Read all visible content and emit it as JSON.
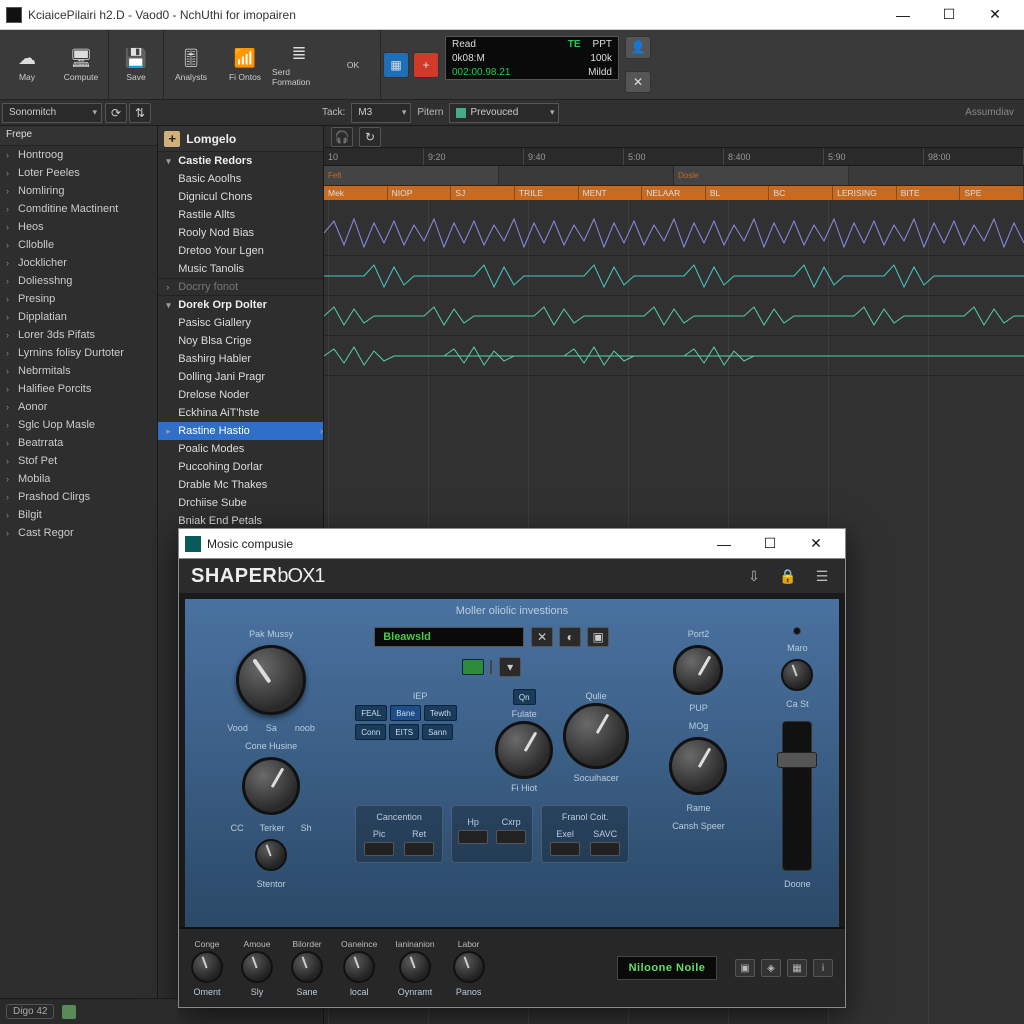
{
  "window": {
    "title": "KciaicePilairi h2.D - Vaod0 - NchUthi for imopairen"
  },
  "toolbar": {
    "may_label": "May",
    "compute_label": "Compute",
    "save_label": "Save",
    "analysts_label": "Analysts",
    "fi_ontos_label": "Fi Ontos",
    "serd_label": "Serd Formation",
    "ok_label": "OK"
  },
  "transport": {
    "lcd_top": {
      "mode": "Read",
      "te": "TE",
      "ppt": "PPT"
    },
    "lcd_bot": {
      "pos": "0k08:M",
      "rate": "100k"
    },
    "lcd_extra": {
      "bars": "002:00.98.21",
      "status": "Mildd"
    }
  },
  "subbar": {
    "search_label": "Sonomitch",
    "track_label": "Tack:",
    "track_value": "M3",
    "preset_label": "Pitern",
    "preset_value": "Prevouced",
    "rightlabel": "Assumdiav"
  },
  "left_header": "Frepe",
  "left_items": [
    "Hontroog",
    "Loter Peeles",
    "Nomliring",
    "Comditine Mactinent",
    "Heos",
    "Clloblle",
    "Jocklicher",
    "Doliesshng",
    "Presinp",
    "Dipplatian",
    "Lorer 3ds Pifats",
    "Lyrnins folisy Durtoter",
    "Nebrmitals",
    "Halifiee Porcits",
    "Aonor",
    "Sglc Uop Masle",
    "Beatrrata",
    "Stof Pet",
    "Mobila",
    "Prashod Clirgs",
    "Bilgit",
    "Cast Regor"
  ],
  "mid_title": "Lomgelo",
  "mid_groups": {
    "g1": "Castie Redors",
    "g1_items": [
      "Basic Aoolhs",
      "Dignicul Chons",
      "Rastile Allts",
      "Rooly Nod Bias",
      "Dretoo Your Lgen",
      "Music Tanolis"
    ],
    "placeholder": "Docrry fonot",
    "g2": "Dorek Orp Dolter",
    "g2_items": [
      "Pasisc Giallery",
      "Noy Blsa Crige",
      "Bashirg Habler",
      "Dolling Jani Pragr",
      "Drelose Noder",
      "Eckhina AiT'hste",
      "Rastine Hastio",
      "Poalic Modes",
      "Puccohing Dorlar",
      "Drable Mc Thakes",
      "Drchiise Sube",
      "Bniak End Petals"
    ],
    "selected_index": 6
  },
  "ruler": [
    "10",
    "9:20",
    "9:40",
    "5:00",
    "8:400",
    "5:90",
    "98:00"
  ],
  "track_header_cells": [
    "Mek",
    "NIOP",
    "SJ",
    "TRILE",
    "MENT",
    "NELAAR",
    "BL",
    "BC",
    "LERISING",
    "BITE",
    "SPE"
  ],
  "track_mini": [
    "Felt",
    "",
    "Dosle",
    ""
  ],
  "status_bar": {
    "chip": "Digo 42"
  },
  "plugin": {
    "title": "Mosic compusie",
    "logo_main": "SHAPER",
    "logo_box": "bOX1",
    "section_title": "Moller oliolic investions",
    "preset_screen": "Bleawsld",
    "port_label": "Port2",
    "pup_label": "PUP",
    "mos_label": "MOg",
    "maro_label": "Maro",
    "ca_label": "Ca St",
    "done_label": "Doone",
    "left": {
      "top1": "Pak  Mussy",
      "vood": "Vood",
      "sa": "Sa",
      "noob": "noob",
      "cone": "Cone Husine",
      "cc": "CC",
      "terker": "Terker",
      "sh": "Sh",
      "stentor": "Stentor"
    },
    "center": {
      "iep": "IEP",
      "qn": "Qn",
      "fulate": "Fulate",
      "oulie": "Qulie",
      "btns": [
        "FEAL",
        "Bane",
        "Tewth",
        "Conn",
        "EITS",
        "Sann"
      ],
      "fihiot": "Fi Hiot",
      "sooihacer": "Socuihacer",
      "box_l_title": "Cancention",
      "pic": "Pic",
      "ret": "Ret",
      "hp": "Hp",
      "cxrp": "Cxrp",
      "box_r_title": "Franol Coit.",
      "exel": "Exel",
      "savc": "SAVC"
    },
    "right": {
      "rame": "Rame",
      "cansh": "Cansh Speer"
    },
    "foot": {
      "k1t": "Conge",
      "k1b": "Oment",
      "k2t": "Amoue",
      "k2b": "Sly",
      "k3t": "Bilorder",
      "k3b": "Sane",
      "k4t": "Oaneince",
      "k4b": "local",
      "k5t": "Ianinanion",
      "k5b": "Oynramt",
      "k6t": "Labor",
      "k6b": "Panos",
      "lcd": "Niloone Noile"
    }
  }
}
